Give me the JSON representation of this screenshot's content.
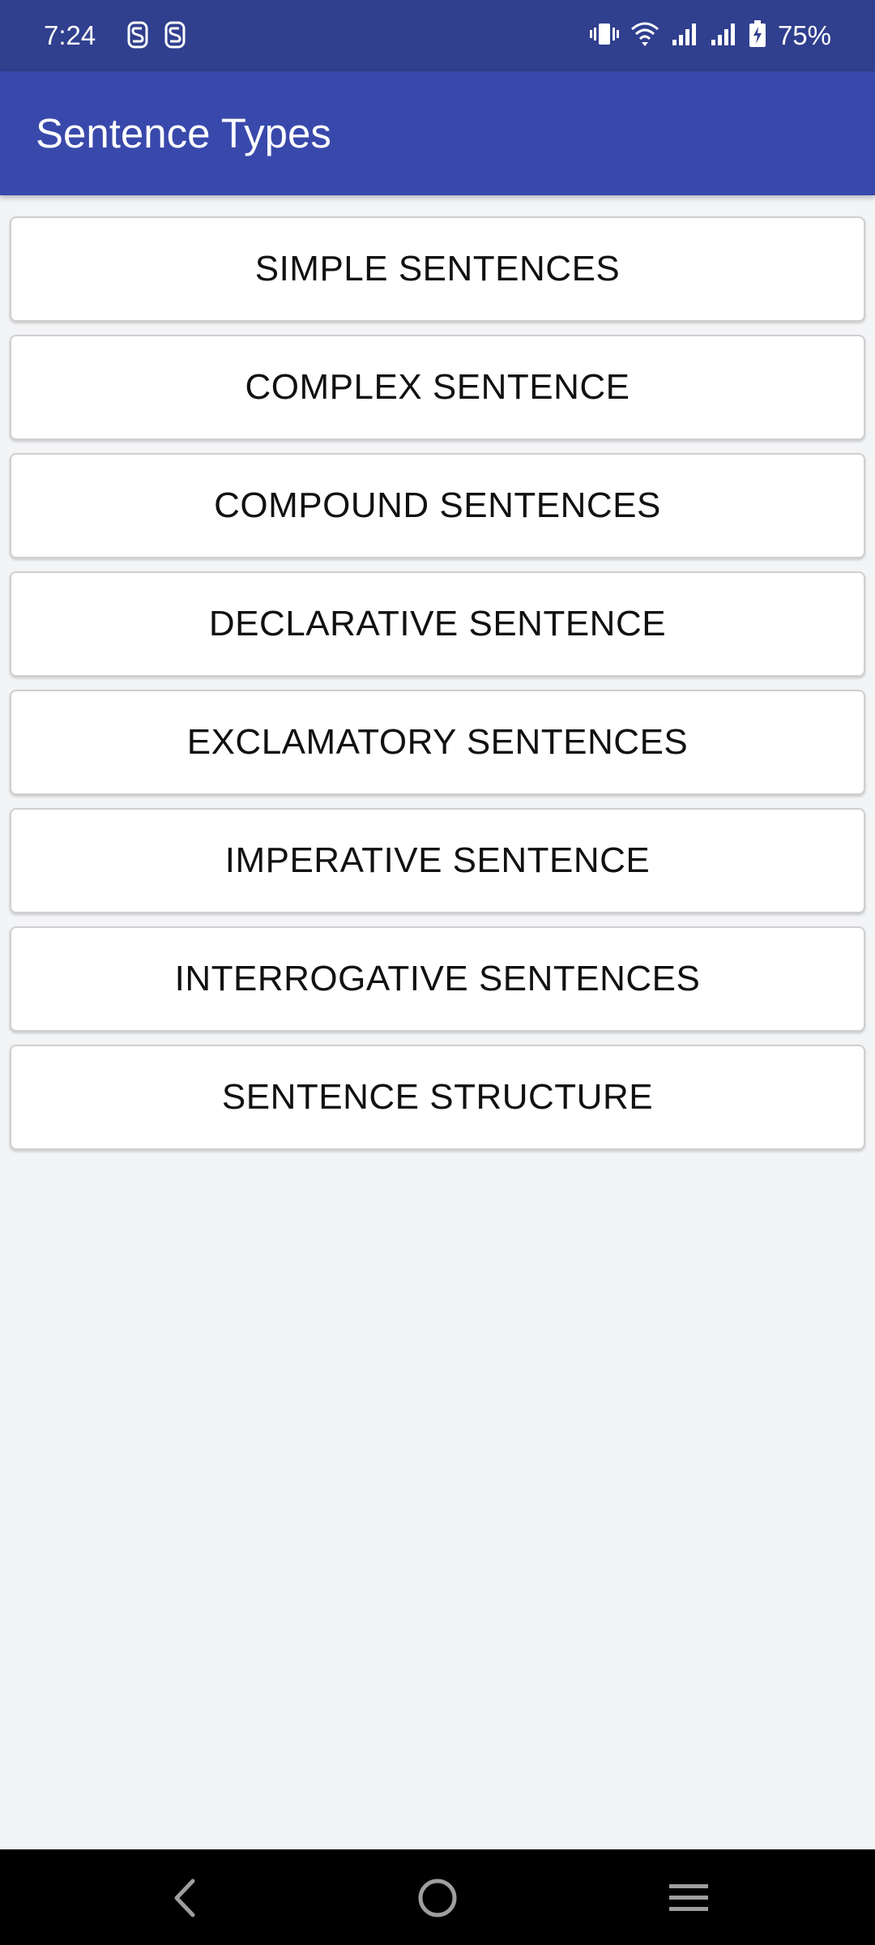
{
  "status_bar": {
    "time": "7:24",
    "battery": "75%",
    "icons": [
      "s-app-icon",
      "s-app-icon",
      "vibrate-icon",
      "wifi-icon",
      "signal-icon",
      "signal-icon",
      "battery-charging-icon"
    ]
  },
  "app_bar": {
    "title": "Sentence Types"
  },
  "menu": {
    "items": [
      {
        "label": "SIMPLE SENTENCES"
      },
      {
        "label": "COMPLEX SENTENCE"
      },
      {
        "label": "COMPOUND SENTENCES"
      },
      {
        "label": "DECLARATIVE SENTENCE"
      },
      {
        "label": "EXCLAMATORY SENTENCES"
      },
      {
        "label": "IMPERATIVE SENTENCE"
      },
      {
        "label": "INTERROGATIVE SENTENCES"
      },
      {
        "label": "SENTENCE STRUCTURE"
      }
    ]
  },
  "nav_bar": {
    "icons": [
      "back-icon",
      "home-icon",
      "recents-icon"
    ]
  },
  "colors": {
    "status_bar": "#303f8e",
    "app_bar": "#3949ab",
    "background": "#f3f4f6"
  }
}
